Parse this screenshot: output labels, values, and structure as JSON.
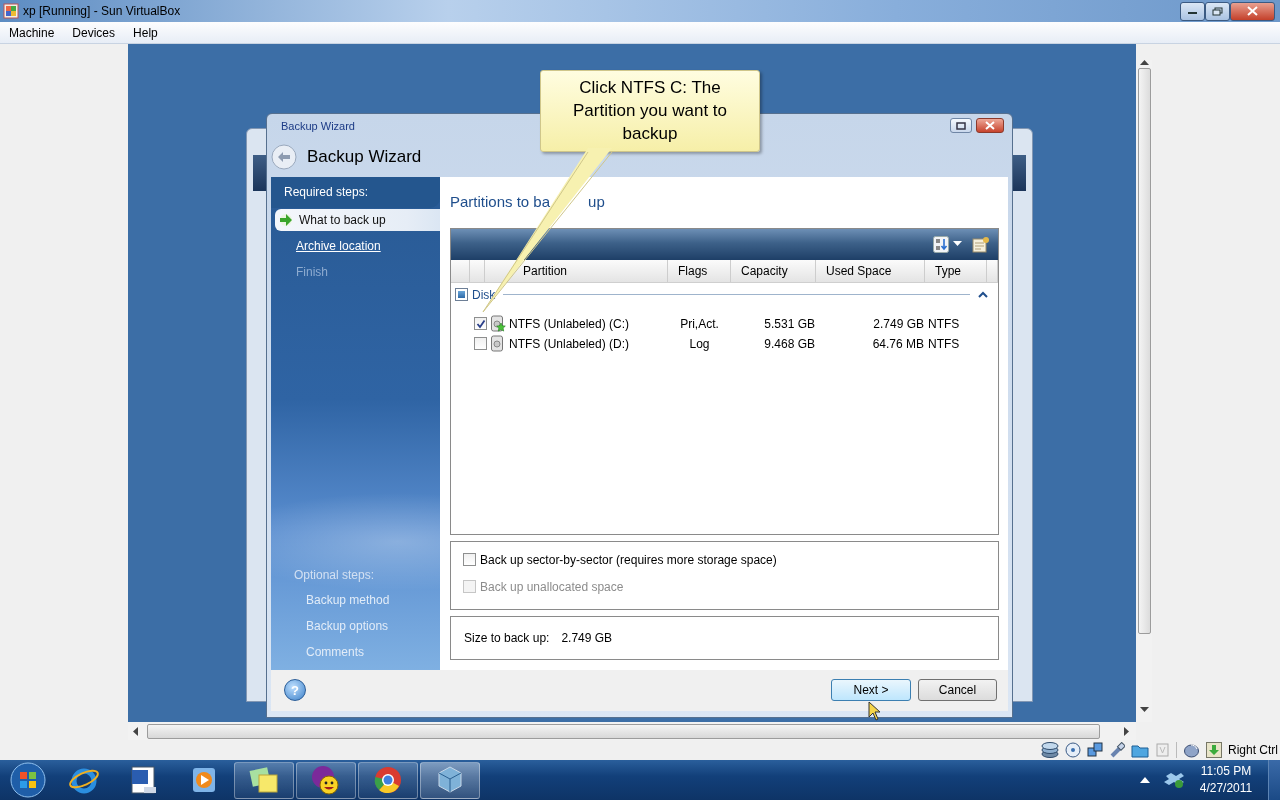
{
  "window": {
    "title": "xp [Running] - Sun VirtualBox"
  },
  "menu": [
    "Machine",
    "Devices",
    "Help"
  ],
  "wizard": {
    "window_title": "Backup Wizard",
    "header": "Backup Wizard",
    "required_label": "Required steps:",
    "steps": [
      {
        "label": "What to back up",
        "selected": true,
        "kind": "current"
      },
      {
        "label": "Archive location",
        "selected": false,
        "kind": "link"
      },
      {
        "label": "Finish",
        "selected": false,
        "kind": "disabled"
      }
    ],
    "optional_label": "Optional steps:",
    "optional_steps": [
      "Backup method",
      "Backup options",
      "Comments"
    ],
    "section_title_parts": [
      "Partitions to ba",
      "up"
    ],
    "table": {
      "columns": [
        "Partition",
        "Flags",
        "Capacity",
        "Used Space",
        "Type"
      ],
      "group": {
        "label": "Disk",
        "expanded": true,
        "partial": true
      },
      "rows": [
        {
          "checked": true,
          "kind": "system",
          "partition": "NTFS (Unlabeled) (C:)",
          "flags": "Pri,Act.",
          "capacity": "5.531 GB",
          "used": "2.749 GB",
          "type": "NTFS"
        },
        {
          "checked": false,
          "kind": "data",
          "partition": "NTFS (Unlabeled) (D:)",
          "flags": "Log",
          "capacity": "9.468 GB",
          "used": "64.76 MB",
          "type": "NTFS"
        }
      ]
    },
    "options": [
      {
        "label": "Back up sector-by-sector (requires more storage space)",
        "checked": false,
        "disabled": false
      },
      {
        "label": "Back up unallocated space",
        "checked": false,
        "disabled": true
      }
    ],
    "size_label": "Size to back up:",
    "size_value": "2.749 GB",
    "help_glyph": "?",
    "buttons": [
      {
        "label": "Next >",
        "kind": "primary"
      },
      {
        "label": "Cancel",
        "kind": "default"
      }
    ]
  },
  "callout": {
    "text": "Click NTFS C: The Partition you want to backup"
  },
  "status_bar": {
    "host_key": "Right Ctrl"
  },
  "tray": {
    "time": "11:05 PM",
    "date": "4/27/2011"
  }
}
